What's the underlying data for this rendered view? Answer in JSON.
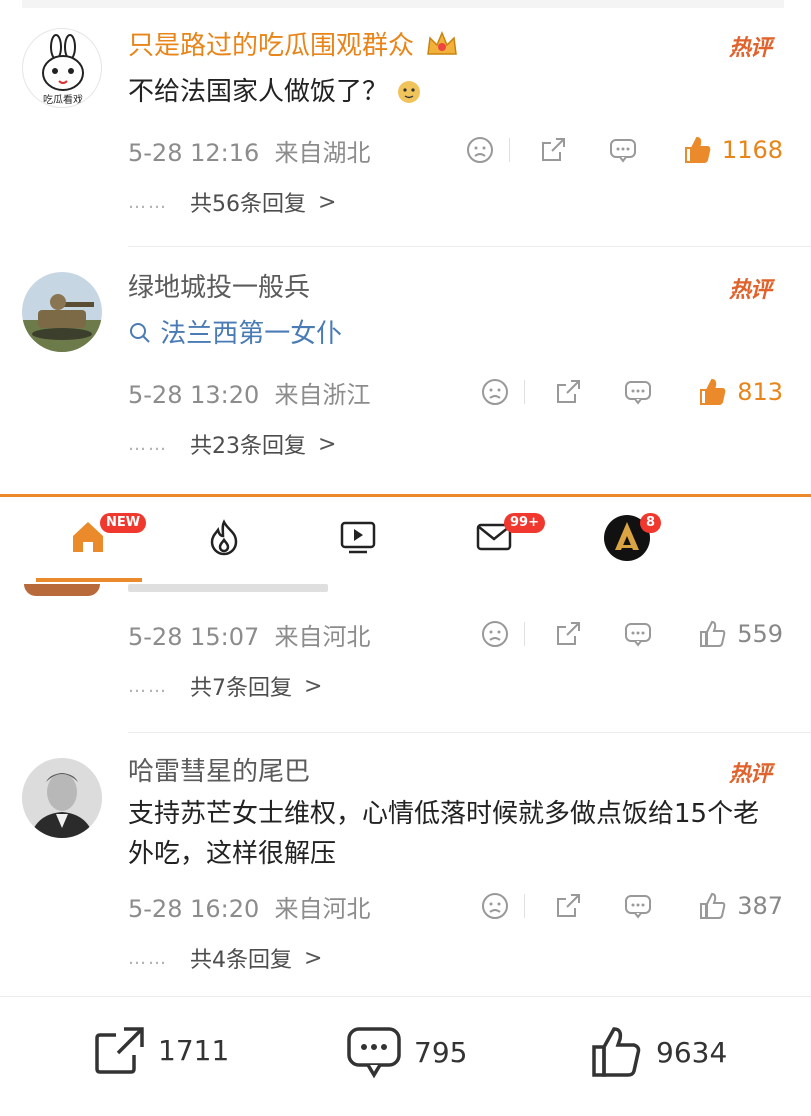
{
  "comments": [
    {
      "username": "只是路过的吃瓜围观群众",
      "crown_icon": "crown-icon",
      "hot_label": "热评",
      "text": "不给法国家人做饭了？",
      "emoji": "doge-emoji",
      "time": "5-28 12:16",
      "location": "来自湖北",
      "likes": "1168",
      "replies": "共56条回复"
    },
    {
      "username": "绿地城投一般兵",
      "hot_label": "热评",
      "search_text": "法兰西第一女仆",
      "time": "5-28 13:20",
      "location": "来自浙江",
      "likes": "813",
      "replies": "共23条回复"
    },
    {
      "time": "5-28 15:07",
      "location": "来自河北",
      "likes": "559",
      "replies": "共7条回复"
    },
    {
      "username": "哈雷彗星的尾巴",
      "hot_label": "热评",
      "text": "支持苏芒女士维权，心情低落时候就多做点饭给15个老外吃，这样很解压",
      "time": "5-28 16:20",
      "location": "来自河北",
      "likes": "387",
      "replies": "共4条回复"
    }
  ],
  "reply_dots": "……",
  "tabbar": {
    "home_badge": "NEW",
    "mail_badge": "99+",
    "profile_badge": "8",
    "accent": "#ea8a2a"
  },
  "bottom": {
    "reposts": "1711",
    "comments": "795",
    "likes": "9634"
  },
  "colors": {
    "accent": "#ea8a2a",
    "link": "#4a7bb5",
    "badge": "#f0382f"
  }
}
